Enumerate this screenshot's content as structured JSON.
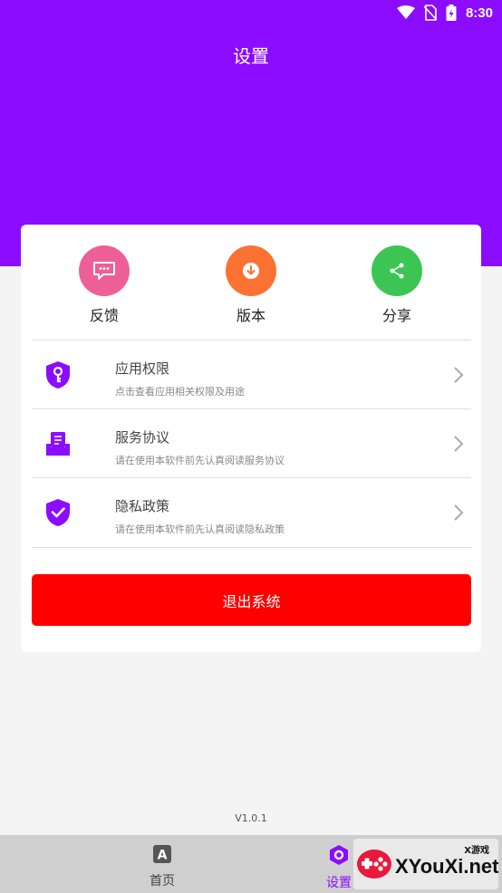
{
  "status_bar": {
    "time": "8:30",
    "icons": [
      "wifi-icon",
      "no-sim-icon",
      "battery-charging-icon"
    ]
  },
  "header": {
    "title": "设置"
  },
  "quick_actions": [
    {
      "label": "反馈",
      "icon": "feedback-icon",
      "color": "#ee5f97"
    },
    {
      "label": "版本",
      "icon": "download-icon",
      "color": "#fb7233"
    },
    {
      "label": "分享",
      "icon": "share-icon",
      "color": "#3cc552"
    }
  ],
  "menu": [
    {
      "title": "应用权限",
      "subtitle": "点击查看应用相关权限及用途",
      "icon": "key-shield-icon"
    },
    {
      "title": "服务协议",
      "subtitle": "请在使用本软件前先认真阅读服务协议",
      "icon": "document-tray-icon"
    },
    {
      "title": "隐私政策",
      "subtitle": "请在使用本软件前先认真阅读隐私政策",
      "icon": "check-shield-icon"
    }
  ],
  "logout_label": "退出系统",
  "version": "V1.0.1",
  "tabs": [
    {
      "label": "首页",
      "icon": "app-a-icon",
      "active": false
    },
    {
      "label": "设置",
      "icon": "settings-hex-icon",
      "active": true
    }
  ],
  "watermark": {
    "brand": "XYouXi.net",
    "tagline": "X游戏"
  },
  "colors": {
    "accent": "#8b0cff",
    "danger": "#ff0000",
    "background": "#f4f4f4"
  }
}
